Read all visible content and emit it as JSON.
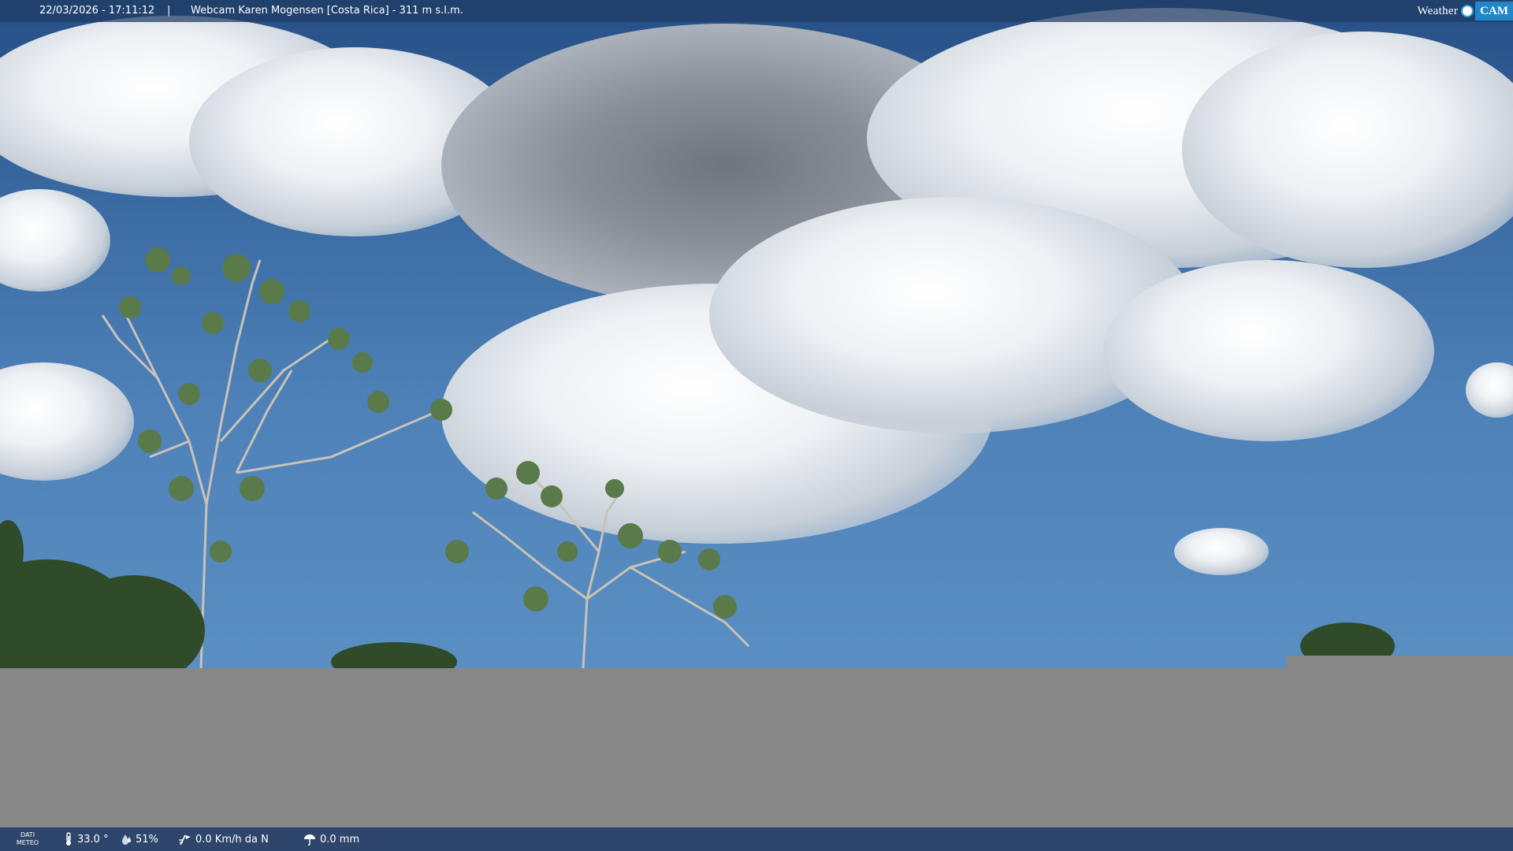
{
  "header": {
    "datetime": "22/03/2026 - 17:11:12",
    "separator": "|",
    "title": "Webcam Karen Mogensen [Costa Rica]  - 311 m s.l.m."
  },
  "brand": {
    "weather": "Weather",
    "cam": "CAM"
  },
  "footer": {
    "dati_line1": "DATI",
    "dati_line2": "METEO",
    "temperature": "33.0 °",
    "humidity": "51%",
    "wind": "0.0 Km/h da N",
    "rain": "0.0 mm"
  },
  "icons": [
    "thermometer-icon",
    "humidity-icon",
    "wind-icon",
    "rain-icon"
  ],
  "colors": {
    "sky": "#4d81b8",
    "mask": "#878787",
    "bar": "#264068",
    "brand_accent": "#1e88c8"
  }
}
